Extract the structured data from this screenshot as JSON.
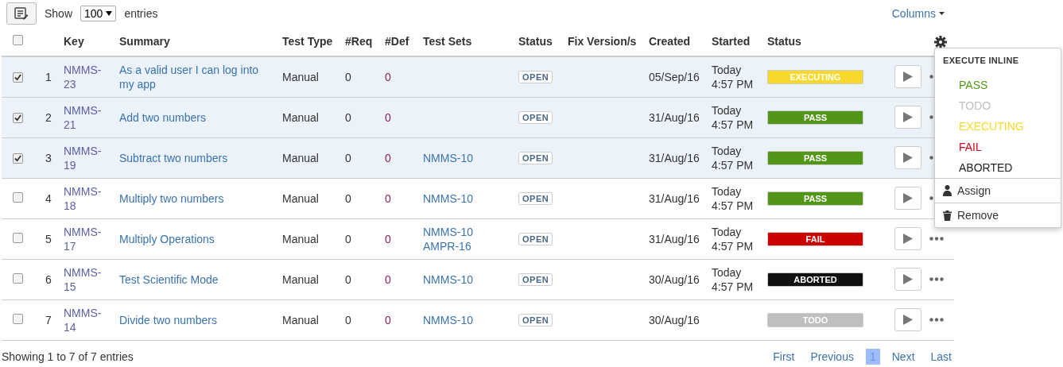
{
  "toolbar": {
    "show_label": "Show",
    "page_size": "100",
    "entries_label": "entries",
    "columns_button": "Columns"
  },
  "table": {
    "all_checked": false,
    "columns": [
      "Key",
      "Summary",
      "Test Type",
      "#Req",
      "#Def",
      "Test Sets",
      "Status",
      "Fix Version/s",
      "Created",
      "Started",
      "Status"
    ],
    "rows": [
      {
        "checked": true,
        "num": "1",
        "key": [
          "NMMS-",
          "23"
        ],
        "summary": "As a valid user I can log into my app",
        "type": "Manual",
        "req": "0",
        "def": "0",
        "sets": [],
        "status": "OPEN",
        "created": "05/Sep/16",
        "started": [
          "Today",
          "4:57 PM"
        ],
        "result": {
          "label": "EXECUTING",
          "color": "#f6d92b"
        }
      },
      {
        "checked": true,
        "num": "2",
        "key": [
          "NMMS-",
          "21"
        ],
        "summary": "Add two numbers",
        "type": "Manual",
        "req": "0",
        "def": "0",
        "sets": [],
        "status": "OPEN",
        "created": "31/Aug/16",
        "started": [
          "Today",
          "4:57 PM"
        ],
        "result": {
          "label": "PASS",
          "color": "#529618"
        }
      },
      {
        "checked": true,
        "num": "3",
        "key": [
          "NMMS-",
          "19"
        ],
        "summary": "Subtract two numbers",
        "type": "Manual",
        "req": "0",
        "def": "0",
        "sets": [
          "NMMS-10"
        ],
        "status": "OPEN",
        "created": "31/Aug/16",
        "started": [
          "Today",
          "4:57 PM"
        ],
        "result": {
          "label": "PASS",
          "color": "#529618"
        }
      },
      {
        "checked": false,
        "num": "4",
        "key": [
          "NMMS-",
          "18"
        ],
        "summary": "Multiply two numbers",
        "type": "Manual",
        "req": "0",
        "def": "0",
        "sets": [
          "NMMS-10"
        ],
        "status": "OPEN",
        "created": "31/Aug/16",
        "started": [
          "Today",
          "4:57 PM"
        ],
        "result": {
          "label": "PASS",
          "color": "#529618"
        }
      },
      {
        "checked": false,
        "num": "5",
        "key": [
          "NMMS-",
          "17"
        ],
        "summary": "Multiply Operations",
        "type": "Manual",
        "req": "0",
        "def": "0",
        "sets": [
          "NMMS-10",
          "AMPR-16"
        ],
        "status": "OPEN",
        "created": "31/Aug/16",
        "started": [
          "Today",
          "4:57 PM"
        ],
        "result": {
          "label": "FAIL",
          "color": "#cc0000"
        }
      },
      {
        "checked": false,
        "num": "6",
        "key": [
          "NMMS-",
          "15"
        ],
        "summary": "Test Scientific Mode",
        "type": "Manual",
        "req": "0",
        "def": "0",
        "sets": [
          "NMMS-10"
        ],
        "status": "OPEN",
        "created": "30/Aug/16",
        "started": [
          "Today",
          "4:57 PM"
        ],
        "result": {
          "label": "ABORTED",
          "color": "#111111"
        }
      },
      {
        "checked": false,
        "num": "7",
        "key": [
          "NMMS-",
          "14"
        ],
        "summary": "Divide two numbers",
        "type": "Manual",
        "req": "0",
        "def": "0",
        "sets": [
          "NMMS-10"
        ],
        "status": "OPEN",
        "created": "30/Aug/16",
        "started": [],
        "result": {
          "label": "TODO",
          "color": "#bfbfbf"
        }
      }
    ]
  },
  "menu": {
    "heading": "EXECUTE INLINE",
    "items": [
      {
        "kind": "status",
        "label": "PASS",
        "color": "#529618"
      },
      {
        "kind": "status",
        "label": "TODO",
        "color": "#bfbfbf"
      },
      {
        "kind": "status",
        "label": "EXECUTING",
        "color": "#f6d92b"
      },
      {
        "kind": "status",
        "label": "FAIL",
        "color": "#d0021b"
      },
      {
        "kind": "status",
        "label": "ABORTED",
        "color": "#222222"
      },
      {
        "kind": "assign",
        "label": "Assign"
      },
      {
        "kind": "remove",
        "label": "Remove"
      }
    ]
  },
  "footer": {
    "info": "Showing 1 to 7 of 7 entries",
    "pages": [
      {
        "label": "First",
        "selected": false
      },
      {
        "label": "Previous",
        "selected": false
      },
      {
        "label": "1",
        "selected": true
      },
      {
        "label": "Next",
        "selected": false
      },
      {
        "label": "Last",
        "selected": false
      }
    ]
  }
}
